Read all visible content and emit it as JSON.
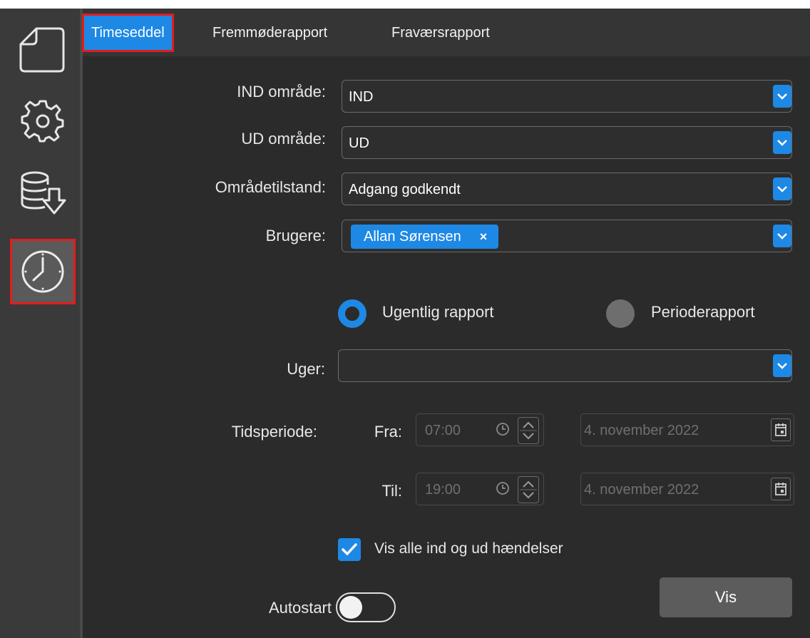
{
  "tabs": [
    {
      "label": "Timeseddel"
    },
    {
      "label": "Fremmøderapport"
    },
    {
      "label": "Fraværsrapport"
    }
  ],
  "filters": {
    "ind_label": "IND område:",
    "ind_value": "IND",
    "ud_label": "UD område:",
    "ud_value": "UD",
    "state_label": "Områdetilstand:",
    "state_value": "Adgang godkendt",
    "users_label": "Brugere:",
    "user_chip": "Allan Sørensen",
    "chip_remove": "×"
  },
  "report": {
    "weekly_label": "Ugentlig rapport",
    "period_label": "Perioderapport",
    "selected": "weekly"
  },
  "weeks": {
    "label": "Uger:",
    "value": ""
  },
  "period": {
    "label": "Tidsperiode:",
    "from_label": "Fra:",
    "from_time": "07:00",
    "from_date": "4. november 2022",
    "to_label": "Til:",
    "to_time": "19:00",
    "to_date": "4. november 2022"
  },
  "show_all": {
    "label": "Vis alle ind og ud hændelser",
    "checked": true
  },
  "autostart": {
    "label": "Autostart",
    "on": false
  },
  "submit_label": "Vis",
  "colors": {
    "accent": "#1e88e5",
    "highlight": "#e31c1c",
    "background": "#2b2b2b"
  }
}
